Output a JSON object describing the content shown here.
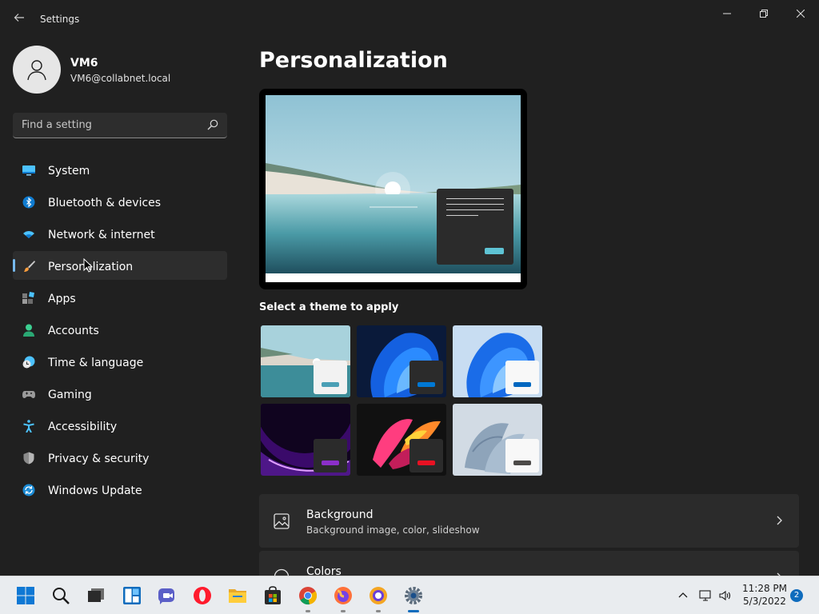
{
  "window": {
    "title": "Settings",
    "back_icon": "back-arrow-icon",
    "minimize_icon": "minimize-icon",
    "maximize_icon": "restore-icon",
    "close_icon": "close-icon"
  },
  "user": {
    "name": "VM6",
    "email": "VM6@collabnet.local",
    "avatar_icon": "person-icon"
  },
  "search": {
    "placeholder": "Find a setting",
    "icon": "search-icon"
  },
  "sidebar": {
    "items": [
      {
        "label": "System",
        "icon": "monitor-icon",
        "active": false
      },
      {
        "label": "Bluetooth & devices",
        "icon": "bluetooth-icon",
        "active": false
      },
      {
        "label": "Network & internet",
        "icon": "wifi-icon",
        "active": false
      },
      {
        "label": "Personalization",
        "icon": "brush-icon",
        "active": true
      },
      {
        "label": "Apps",
        "icon": "apps-icon",
        "active": false
      },
      {
        "label": "Accounts",
        "icon": "person-icon",
        "active": false
      },
      {
        "label": "Time & language",
        "icon": "clock-globe-icon",
        "active": false
      },
      {
        "label": "Gaming",
        "icon": "gamepad-icon",
        "active": false
      },
      {
        "label": "Accessibility",
        "icon": "accessibility-icon",
        "active": false
      },
      {
        "label": "Privacy & security",
        "icon": "shield-icon",
        "active": false
      },
      {
        "label": "Windows Update",
        "icon": "update-icon",
        "active": false
      }
    ]
  },
  "main": {
    "title": "Personalization",
    "theme_section_label": "Select a theme to apply",
    "themes": [
      {
        "name": "glow-lake-theme",
        "accent": "#4a9fb5"
      },
      {
        "name": "bloom-dark-theme",
        "accent": "#0078d4"
      },
      {
        "name": "bloom-light-theme",
        "accent": "#0067c0"
      },
      {
        "name": "glow-purple-theme",
        "accent": "#8b2fc9"
      },
      {
        "name": "captured-motion-theme",
        "accent": "#e81123"
      },
      {
        "name": "flow-theme",
        "accent": "#4c4a48"
      }
    ],
    "cards": [
      {
        "title": "Background",
        "subtitle": "Background image, color, slideshow",
        "icon": "image-icon"
      },
      {
        "title": "Colors",
        "subtitle": "",
        "icon": "palette-icon"
      }
    ]
  },
  "taskbar": {
    "apps": [
      {
        "name": "start-icon",
        "running": false
      },
      {
        "name": "search-icon",
        "running": false
      },
      {
        "name": "task-view-icon",
        "running": false
      },
      {
        "name": "widgets-icon",
        "running": false
      },
      {
        "name": "teams-chat-icon",
        "running": false
      },
      {
        "name": "opera-icon",
        "running": false
      },
      {
        "name": "file-explorer-icon",
        "running": false
      },
      {
        "name": "microsoft-store-icon",
        "running": false
      },
      {
        "name": "chrome-icon",
        "running": true
      },
      {
        "name": "firefox-icon",
        "running": true
      },
      {
        "name": "browser-icon",
        "running": true
      },
      {
        "name": "settings-icon",
        "running": true,
        "active": true
      }
    ],
    "tray": {
      "chevron_icon": "chevron-up-icon",
      "network_icon": "network-icon",
      "volume_icon": "volume-icon",
      "time": "11:28 PM",
      "date": "5/3/2022",
      "notification_count": "2"
    }
  },
  "colors": {
    "background": "#202020",
    "accent": "#76b9ed",
    "card": "#2b2b2b"
  }
}
